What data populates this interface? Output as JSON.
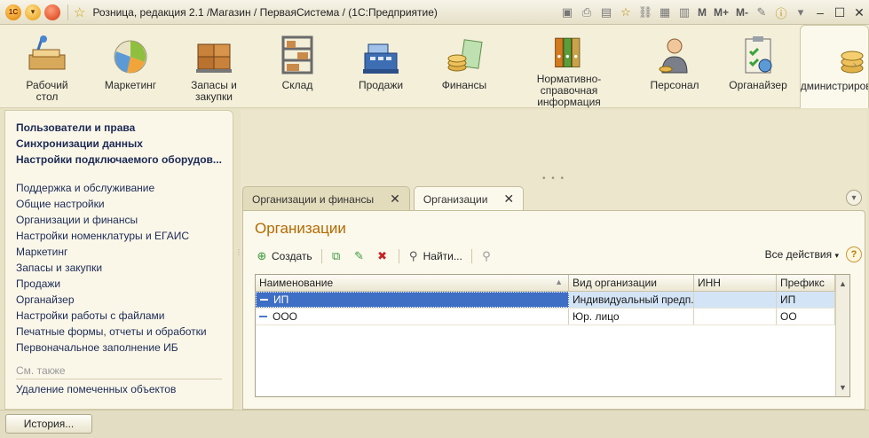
{
  "window": {
    "title": "Розница, редакция 2.1 /Магазин / ПерваяСистема /  (1С:Предприятие)",
    "toolbar_m": "M",
    "toolbar_mplus": "M+",
    "toolbar_mminus": "M-"
  },
  "sections": [
    {
      "label": "Рабочий стол"
    },
    {
      "label": "Маркетинг"
    },
    {
      "label": "Запасы и закупки"
    },
    {
      "label": "Склад"
    },
    {
      "label": "Продажи"
    },
    {
      "label": "Финансы"
    },
    {
      "label": "Нормативно-справочная информация"
    },
    {
      "label": "Персонал"
    },
    {
      "label": "Органайзер"
    },
    {
      "label": "Администрирование"
    }
  ],
  "leftnav": {
    "bold_items": [
      "Пользователи и права",
      "Синхронизации данных",
      "Настройки подключаемого оборудов..."
    ],
    "items": [
      "Поддержка и обслуживание",
      "Общие настройки",
      "Организации и финансы",
      "Настройки номенклатуры и ЕГАИС",
      "Маркетинг",
      "Запасы и закупки",
      "Продажи",
      "Органайзер",
      "Настройки работы с файлами",
      "Печатные формы, отчеты и обработки",
      "Первоначальное заполнение ИБ"
    ],
    "see_also_title": "См. также",
    "see_also_items": [
      "Удаление помеченных объектов"
    ]
  },
  "tabs": [
    {
      "label": "Организации и финансы",
      "active": false
    },
    {
      "label": "Организации",
      "active": true
    }
  ],
  "form": {
    "title": "Организации",
    "create_label": "Создать",
    "find_label": "Найти...",
    "all_actions_label": "Все действия",
    "help_label": "?"
  },
  "table": {
    "columns": [
      "Наименование",
      "Вид организации",
      "ИНН",
      "Префикс"
    ],
    "rows": [
      {
        "name": "ИП",
        "kind": "Индивидуальный предп...",
        "inn": "",
        "prefix": "ИП",
        "selected": true
      },
      {
        "name": "ООО",
        "kind": "Юр. лицо",
        "inn": "",
        "prefix": "ОО",
        "selected": false
      }
    ]
  },
  "bottom": {
    "history_label": "История..."
  },
  "colors": {
    "accent_title": "#b26b00",
    "link": "#1c2a55",
    "selection": "#3f6fc4"
  }
}
